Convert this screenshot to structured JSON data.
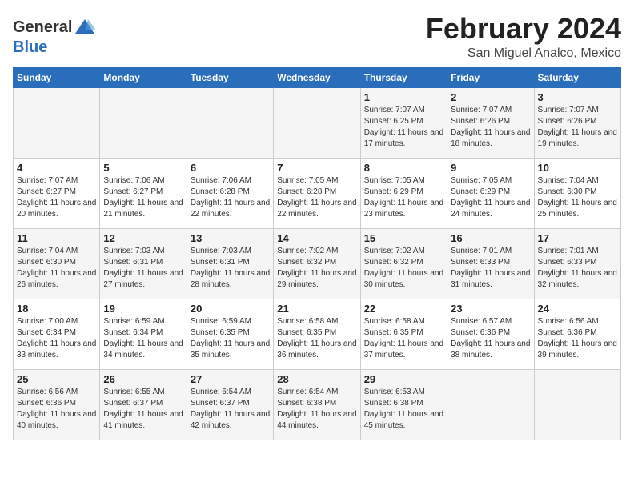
{
  "header": {
    "logo_general": "General",
    "logo_blue": "Blue",
    "main_title": "February 2024",
    "sub_title": "San Miguel Analco, Mexico"
  },
  "days_of_week": [
    "Sunday",
    "Monday",
    "Tuesday",
    "Wednesday",
    "Thursday",
    "Friday",
    "Saturday"
  ],
  "weeks": [
    [
      {
        "day": "",
        "info": ""
      },
      {
        "day": "",
        "info": ""
      },
      {
        "day": "",
        "info": ""
      },
      {
        "day": "",
        "info": ""
      },
      {
        "day": "1",
        "info": "Sunrise: 7:07 AM\nSunset: 6:25 PM\nDaylight: 11 hours and 17 minutes."
      },
      {
        "day": "2",
        "info": "Sunrise: 7:07 AM\nSunset: 6:26 PM\nDaylight: 11 hours and 18 minutes."
      },
      {
        "day": "3",
        "info": "Sunrise: 7:07 AM\nSunset: 6:26 PM\nDaylight: 11 hours and 19 minutes."
      }
    ],
    [
      {
        "day": "4",
        "info": "Sunrise: 7:07 AM\nSunset: 6:27 PM\nDaylight: 11 hours and 20 minutes."
      },
      {
        "day": "5",
        "info": "Sunrise: 7:06 AM\nSunset: 6:27 PM\nDaylight: 11 hours and 21 minutes."
      },
      {
        "day": "6",
        "info": "Sunrise: 7:06 AM\nSunset: 6:28 PM\nDaylight: 11 hours and 22 minutes."
      },
      {
        "day": "7",
        "info": "Sunrise: 7:05 AM\nSunset: 6:28 PM\nDaylight: 11 hours and 22 minutes."
      },
      {
        "day": "8",
        "info": "Sunrise: 7:05 AM\nSunset: 6:29 PM\nDaylight: 11 hours and 23 minutes."
      },
      {
        "day": "9",
        "info": "Sunrise: 7:05 AM\nSunset: 6:29 PM\nDaylight: 11 hours and 24 minutes."
      },
      {
        "day": "10",
        "info": "Sunrise: 7:04 AM\nSunset: 6:30 PM\nDaylight: 11 hours and 25 minutes."
      }
    ],
    [
      {
        "day": "11",
        "info": "Sunrise: 7:04 AM\nSunset: 6:30 PM\nDaylight: 11 hours and 26 minutes."
      },
      {
        "day": "12",
        "info": "Sunrise: 7:03 AM\nSunset: 6:31 PM\nDaylight: 11 hours and 27 minutes."
      },
      {
        "day": "13",
        "info": "Sunrise: 7:03 AM\nSunset: 6:31 PM\nDaylight: 11 hours and 28 minutes."
      },
      {
        "day": "14",
        "info": "Sunrise: 7:02 AM\nSunset: 6:32 PM\nDaylight: 11 hours and 29 minutes."
      },
      {
        "day": "15",
        "info": "Sunrise: 7:02 AM\nSunset: 6:32 PM\nDaylight: 11 hours and 30 minutes."
      },
      {
        "day": "16",
        "info": "Sunrise: 7:01 AM\nSunset: 6:33 PM\nDaylight: 11 hours and 31 minutes."
      },
      {
        "day": "17",
        "info": "Sunrise: 7:01 AM\nSunset: 6:33 PM\nDaylight: 11 hours and 32 minutes."
      }
    ],
    [
      {
        "day": "18",
        "info": "Sunrise: 7:00 AM\nSunset: 6:34 PM\nDaylight: 11 hours and 33 minutes."
      },
      {
        "day": "19",
        "info": "Sunrise: 6:59 AM\nSunset: 6:34 PM\nDaylight: 11 hours and 34 minutes."
      },
      {
        "day": "20",
        "info": "Sunrise: 6:59 AM\nSunset: 6:35 PM\nDaylight: 11 hours and 35 minutes."
      },
      {
        "day": "21",
        "info": "Sunrise: 6:58 AM\nSunset: 6:35 PM\nDaylight: 11 hours and 36 minutes."
      },
      {
        "day": "22",
        "info": "Sunrise: 6:58 AM\nSunset: 6:35 PM\nDaylight: 11 hours and 37 minutes."
      },
      {
        "day": "23",
        "info": "Sunrise: 6:57 AM\nSunset: 6:36 PM\nDaylight: 11 hours and 38 minutes."
      },
      {
        "day": "24",
        "info": "Sunrise: 6:56 AM\nSunset: 6:36 PM\nDaylight: 11 hours and 39 minutes."
      }
    ],
    [
      {
        "day": "25",
        "info": "Sunrise: 6:56 AM\nSunset: 6:36 PM\nDaylight: 11 hours and 40 minutes."
      },
      {
        "day": "26",
        "info": "Sunrise: 6:55 AM\nSunset: 6:37 PM\nDaylight: 11 hours and 41 minutes."
      },
      {
        "day": "27",
        "info": "Sunrise: 6:54 AM\nSunset: 6:37 PM\nDaylight: 11 hours and 42 minutes."
      },
      {
        "day": "28",
        "info": "Sunrise: 6:54 AM\nSunset: 6:38 PM\nDaylight: 11 hours and 44 minutes."
      },
      {
        "day": "29",
        "info": "Sunrise: 6:53 AM\nSunset: 6:38 PM\nDaylight: 11 hours and 45 minutes."
      },
      {
        "day": "",
        "info": ""
      },
      {
        "day": "",
        "info": ""
      }
    ]
  ]
}
